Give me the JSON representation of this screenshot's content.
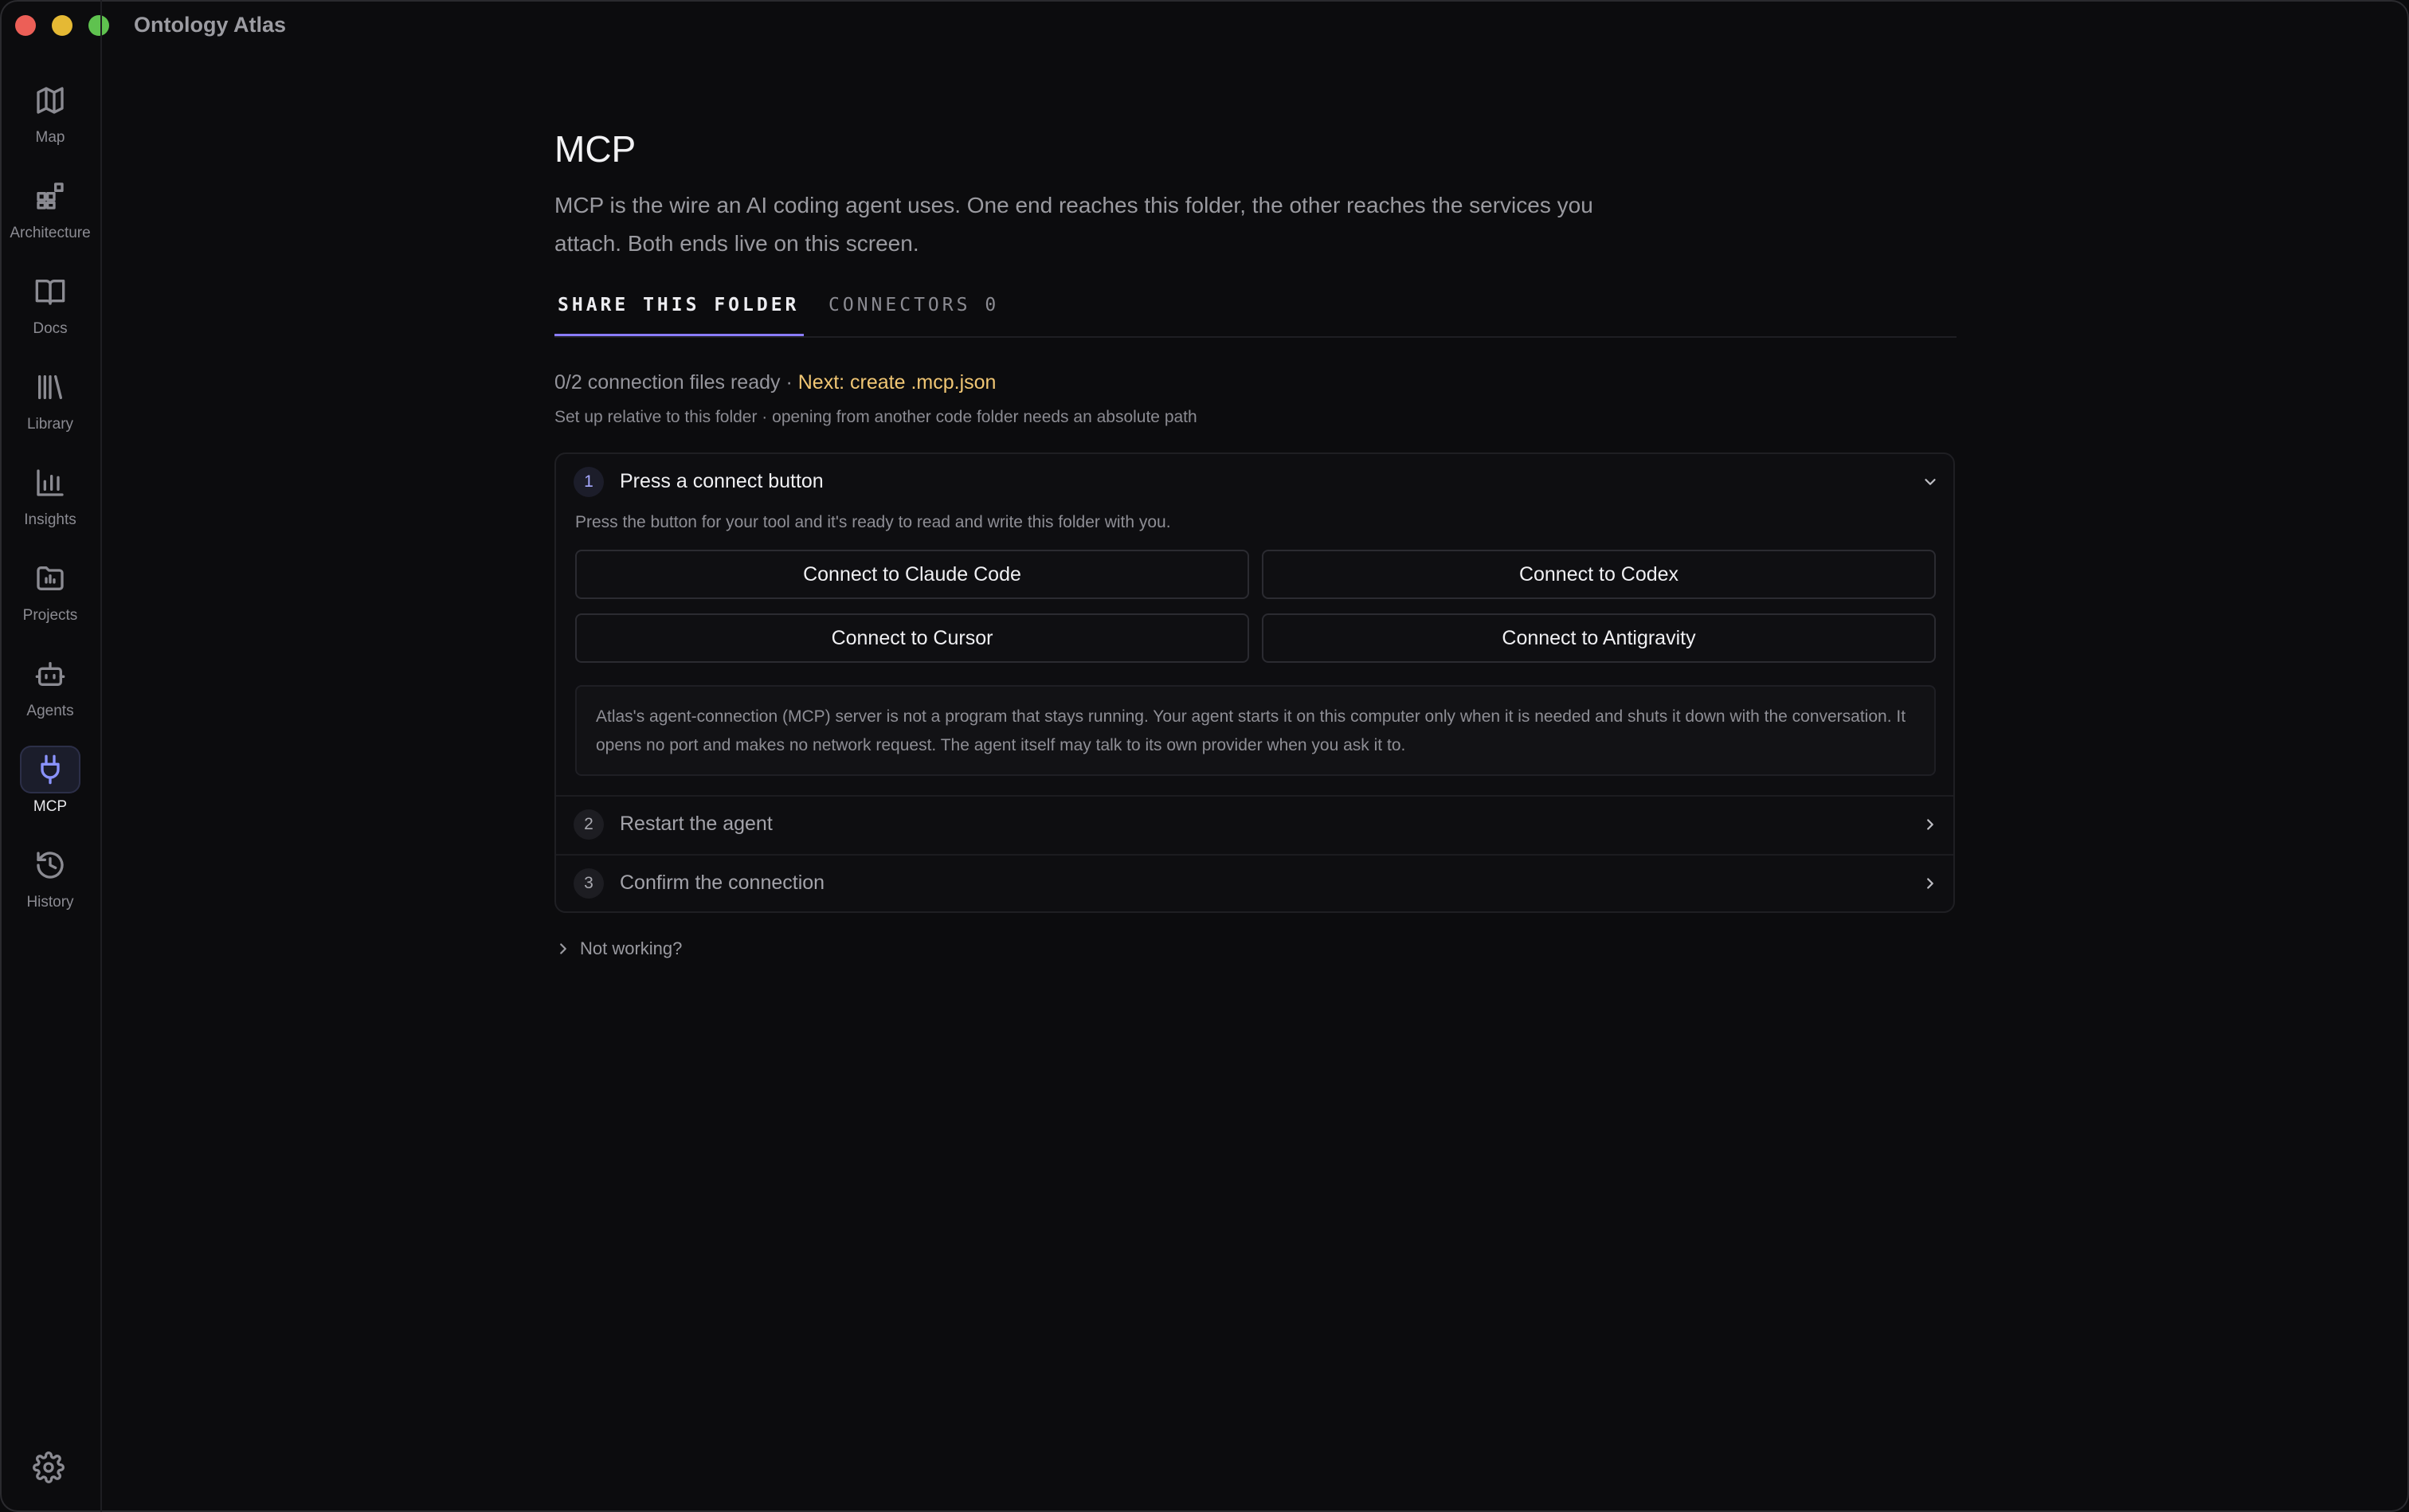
{
  "app": {
    "title": "Ontology Atlas"
  },
  "sidebar": {
    "items": [
      {
        "label": "Map",
        "icon": "map-icon"
      },
      {
        "label": "Architecture",
        "icon": "architecture-icon"
      },
      {
        "label": "Docs",
        "icon": "book-icon"
      },
      {
        "label": "Library",
        "icon": "library-icon"
      },
      {
        "label": "Insights",
        "icon": "bar-chart-icon"
      },
      {
        "label": "Projects",
        "icon": "folder-icon"
      },
      {
        "label": "Agents",
        "icon": "robot-icon"
      },
      {
        "label": "MCP",
        "icon": "plug-icon",
        "active": true
      },
      {
        "label": "History",
        "icon": "history-icon"
      }
    ],
    "settings_icon": "gear-icon"
  },
  "page": {
    "title": "MCP",
    "description": "MCP is the wire an AI coding agent uses. One end reaches this folder, the other reaches the services you attach. Both ends live on this screen."
  },
  "tabs": [
    {
      "label": "SHARE THIS FOLDER",
      "active": true
    },
    {
      "label": "CONNECTORS 0",
      "active": false
    }
  ],
  "status": {
    "ready": "0/2 connection files ready ·",
    "next": "Next: create .mcp.json",
    "sub": "Set up relative to this folder · opening from another code folder needs an absolute path"
  },
  "steps": [
    {
      "number": "1",
      "title": "Press a connect button",
      "expanded": true,
      "description": "Press the button for your tool and it's ready to read and write this folder with you.",
      "buttons": [
        "Connect to Claude Code",
        "Connect to Codex",
        "Connect to Cursor",
        "Connect to Antigravity"
      ],
      "info": "Atlas's agent-connection (MCP) server is not a program that stays running. Your agent starts it on this computer only when it is needed and shuts it down with the conversation. It opens no port and makes no network request. The agent itself may talk to its own provider when you ask it to."
    },
    {
      "number": "2",
      "title": "Restart the agent",
      "expanded": false
    },
    {
      "number": "3",
      "title": "Confirm the connection",
      "expanded": false
    }
  ],
  "troubleshoot": {
    "label": "Not working?"
  },
  "colors": {
    "accent": "#8a7cff",
    "next_highlight": "#f0c674",
    "background": "#0c0c0e"
  }
}
